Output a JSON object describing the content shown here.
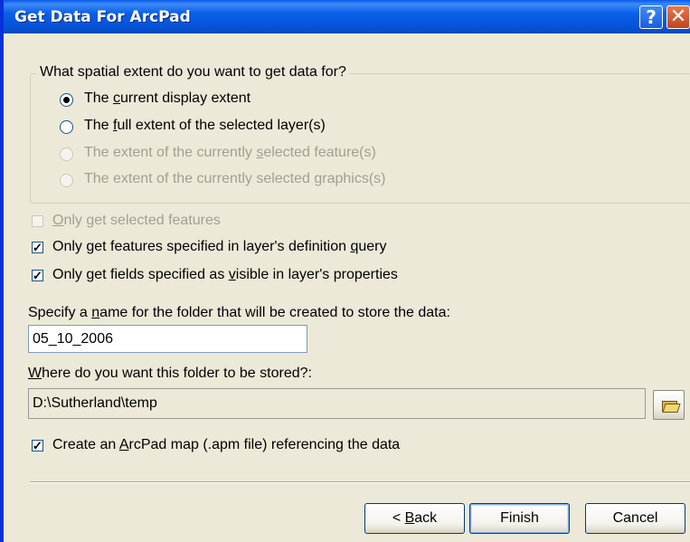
{
  "window": {
    "title": "Get Data For ArcPad",
    "help_label": "?",
    "close_label": "✕"
  },
  "extent_group": {
    "legend": "What spatial extent do you want to get data for?",
    "options": [
      {
        "pre": "The ",
        "key": "c",
        "post": "urrent display extent",
        "checked": true,
        "enabled": true
      },
      {
        "pre": "The ",
        "key": "f",
        "post": "ull extent of the selected layer(s)",
        "checked": false,
        "enabled": true
      },
      {
        "pre": "The extent of the currently ",
        "key": "s",
        "post": "elected feature(s)",
        "checked": false,
        "enabled": false
      },
      {
        "pre": "The extent of the currently selected ",
        "key": "g",
        "post": "raphics(s)",
        "checked": false,
        "enabled": false
      }
    ]
  },
  "checkboxes": [
    {
      "pre": "",
      "key": "O",
      "post": "nly get selected features",
      "checked": false,
      "enabled": false
    },
    {
      "pre": "Only get features specified in layer's definition ",
      "key": "q",
      "post": "uery",
      "checked": true,
      "enabled": true
    },
    {
      "pre": "Only get fields specified as ",
      "key": "v",
      "post": "isible in layer's properties",
      "checked": true,
      "enabled": true
    }
  ],
  "folder_name": {
    "label_pre": "Specify a ",
    "label_key": "n",
    "label_post": "ame for the folder that will be created to store the data:",
    "value": "05_10_2006"
  },
  "folder_location": {
    "label_key": "W",
    "label_post": "here do you want this folder to be stored?:",
    "value": "D:\\Sutherland\\temp",
    "browse_icon": "open-folder-icon"
  },
  "create_map": {
    "pre": "Create an ",
    "key": "A",
    "post": "rcPad map (.apm file) referencing the data",
    "checked": true
  },
  "buttons": {
    "back_pre": "< ",
    "back_key": "B",
    "back_post": "ack",
    "finish": "Finish",
    "cancel": "Cancel"
  },
  "colors": {
    "titlebar": "#0a5fe9",
    "dialog_bg": "#ece9d8",
    "disabled_text": "#a19f93"
  }
}
